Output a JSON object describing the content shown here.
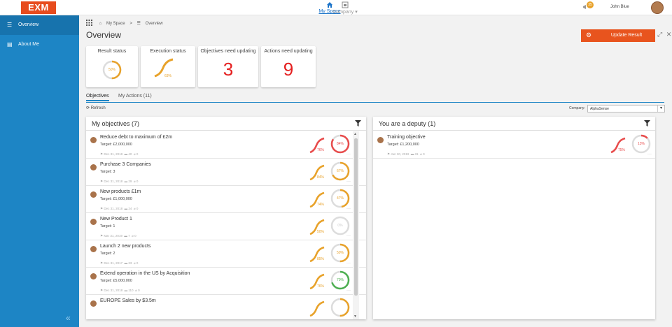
{
  "app": {
    "logo": "EXM"
  },
  "topnav": {
    "my_space": "My Space",
    "company": "Company"
  },
  "user": {
    "name": "John Blue",
    "notifications": "35"
  },
  "sidebar": {
    "items": [
      {
        "label": "Overview",
        "icon": "overview-icon"
      },
      {
        "label": "About Me",
        "icon": "id-card-icon"
      }
    ],
    "collapse": "«"
  },
  "breadcrumb": {
    "home": "My Space",
    "sep": ">",
    "current": "Overview"
  },
  "page": {
    "title": "Overview",
    "update_button": "Update Result"
  },
  "kpis": {
    "result_status": {
      "title": "Result status",
      "value": "50%",
      "fraction": 0.5
    },
    "execution_status": {
      "title": "Execution status",
      "value": "63%",
      "fraction": 0.63
    },
    "objectives_need_updating": {
      "title": "Objectives need updating",
      "value": "3"
    },
    "actions_need_updating": {
      "title": "Actions need updating",
      "value": "9"
    }
  },
  "tabs": {
    "objectives": "Objectives",
    "my_actions": "My Actions (11)"
  },
  "toolbar": {
    "refresh": "Refresh",
    "company_label": "Company:",
    "company_value": "AlphaSense"
  },
  "my_objectives": {
    "title": "My objectives (7)",
    "items": [
      {
        "name": "Reduce debt to maximum of £2m",
        "target": "Target: £2,000,000",
        "date": "Dec 31, 2018",
        "comments": "40",
        "attachments": "0",
        "exec": "76%",
        "result": "84%",
        "result_color": "#e84c4c",
        "result_frac": 0.84
      },
      {
        "name": "Purchase 3 Companies",
        "target": "Target: 3",
        "date": "Dec 31, 2018",
        "comments": "29",
        "attachments": "0",
        "exec": "84%",
        "result": "67%",
        "result_color": "#e8a22a",
        "result_frac": 0.67
      },
      {
        "name": "New products £1m",
        "target": "Target: £1,000,000",
        "date": "Dec 31, 2018",
        "comments": "24",
        "attachments": "0",
        "exec": "74%",
        "result": "47%",
        "result_color": "#e8a22a",
        "result_frac": 0.47
      },
      {
        "name": "New Product 1",
        "target": "Target: 1",
        "date": "Mar 31, 2019",
        "comments": "7",
        "attachments": "0",
        "exec": "50%",
        "result": "0%",
        "result_color": "#cccccc",
        "result_frac": 0
      },
      {
        "name": "Launch 2 new products",
        "target": "Target: 2",
        "date": "Dec 31, 2017",
        "comments": "33",
        "attachments": "0",
        "exec": "85%",
        "result": "50%",
        "result_color": "#e8a22a",
        "result_frac": 0.5
      },
      {
        "name": "Extend operation in the US by Acquisition",
        "target": "Target: £5,000,000",
        "date": "Dec 31, 2018",
        "comments": "110",
        "attachments": "0",
        "exec": "76%",
        "result": "70%",
        "result_color": "#4caf50",
        "result_frac": 0.7
      },
      {
        "name": "EUROPE Sales by $3.5m",
        "target": "",
        "date": "",
        "comments": "",
        "attachments": "",
        "exec": "",
        "result": "",
        "result_color": "#e8a22a",
        "result_frac": 0.5
      }
    ]
  },
  "deputy": {
    "title": "You are a deputy (1)",
    "items": [
      {
        "name": "Training objective",
        "target": "Target: £1,200,000",
        "date": "Jun 30, 2019",
        "comments": "31",
        "attachments": "0",
        "exec": "75%",
        "result": "13%",
        "result_color": "#e84c4c",
        "result_frac": 0.13
      }
    ]
  }
}
